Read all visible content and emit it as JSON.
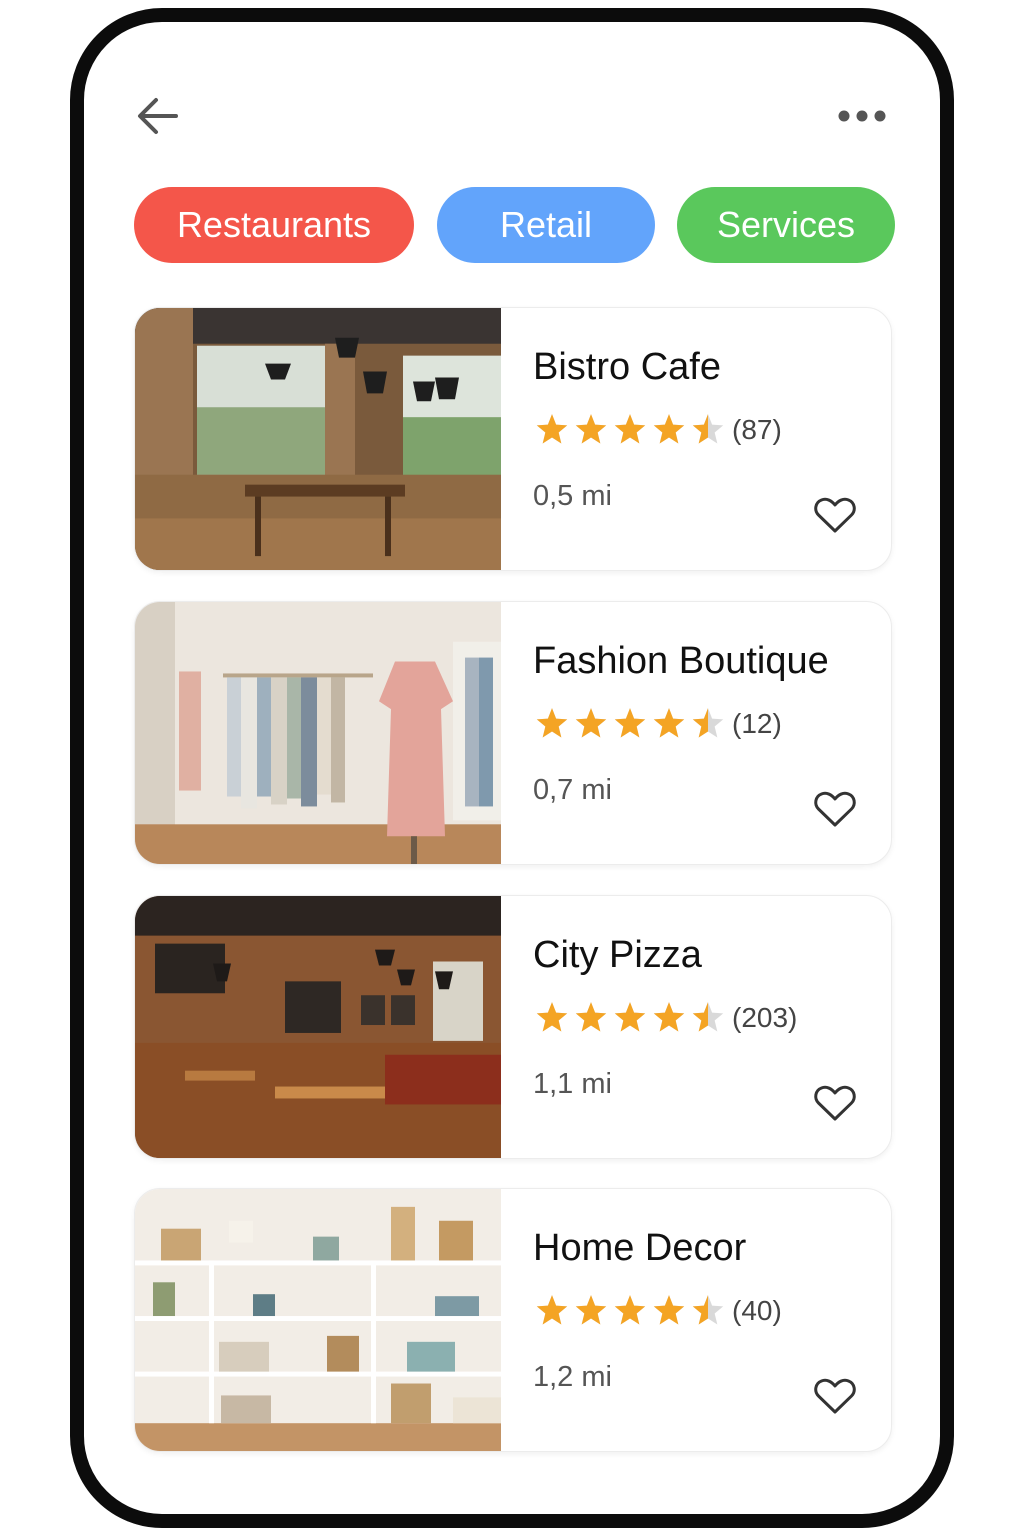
{
  "header": {
    "back_icon": "arrow-left-icon",
    "more_icon": "ellipsis-horizontal-icon"
  },
  "categories": [
    {
      "label": "Restaurants",
      "color": "#f4564a"
    },
    {
      "label": "Retail",
      "color": "#62a4fb"
    },
    {
      "label": "Services",
      "color": "#5ac85c"
    }
  ],
  "rating_star_color": "#f4a424",
  "listings": [
    {
      "name": "Bistro Cafe",
      "rating": 4.5,
      "reviews": "(87)",
      "distance": "0,5 mi",
      "favorite_icon": "heart-outline-icon",
      "image": "bistro-cafe-interior"
    },
    {
      "name": "Fashion Boutique",
      "rating": 4.5,
      "reviews": "(12)",
      "distance": "0,7 mi",
      "favorite_icon": "heart-outline-icon",
      "image": "boutique-clothing-racks"
    },
    {
      "name": "City Pizza",
      "rating": 4.5,
      "reviews": "(203)",
      "distance": "1,1 mi",
      "favorite_icon": "heart-outline-icon",
      "image": "pizza-restaurant-interior"
    },
    {
      "name": "Home Decor",
      "rating": 4.5,
      "reviews": "(40)",
      "distance": "1,2 mi",
      "favorite_icon": "heart-outline-icon",
      "image": "home-decor-shelves"
    }
  ]
}
